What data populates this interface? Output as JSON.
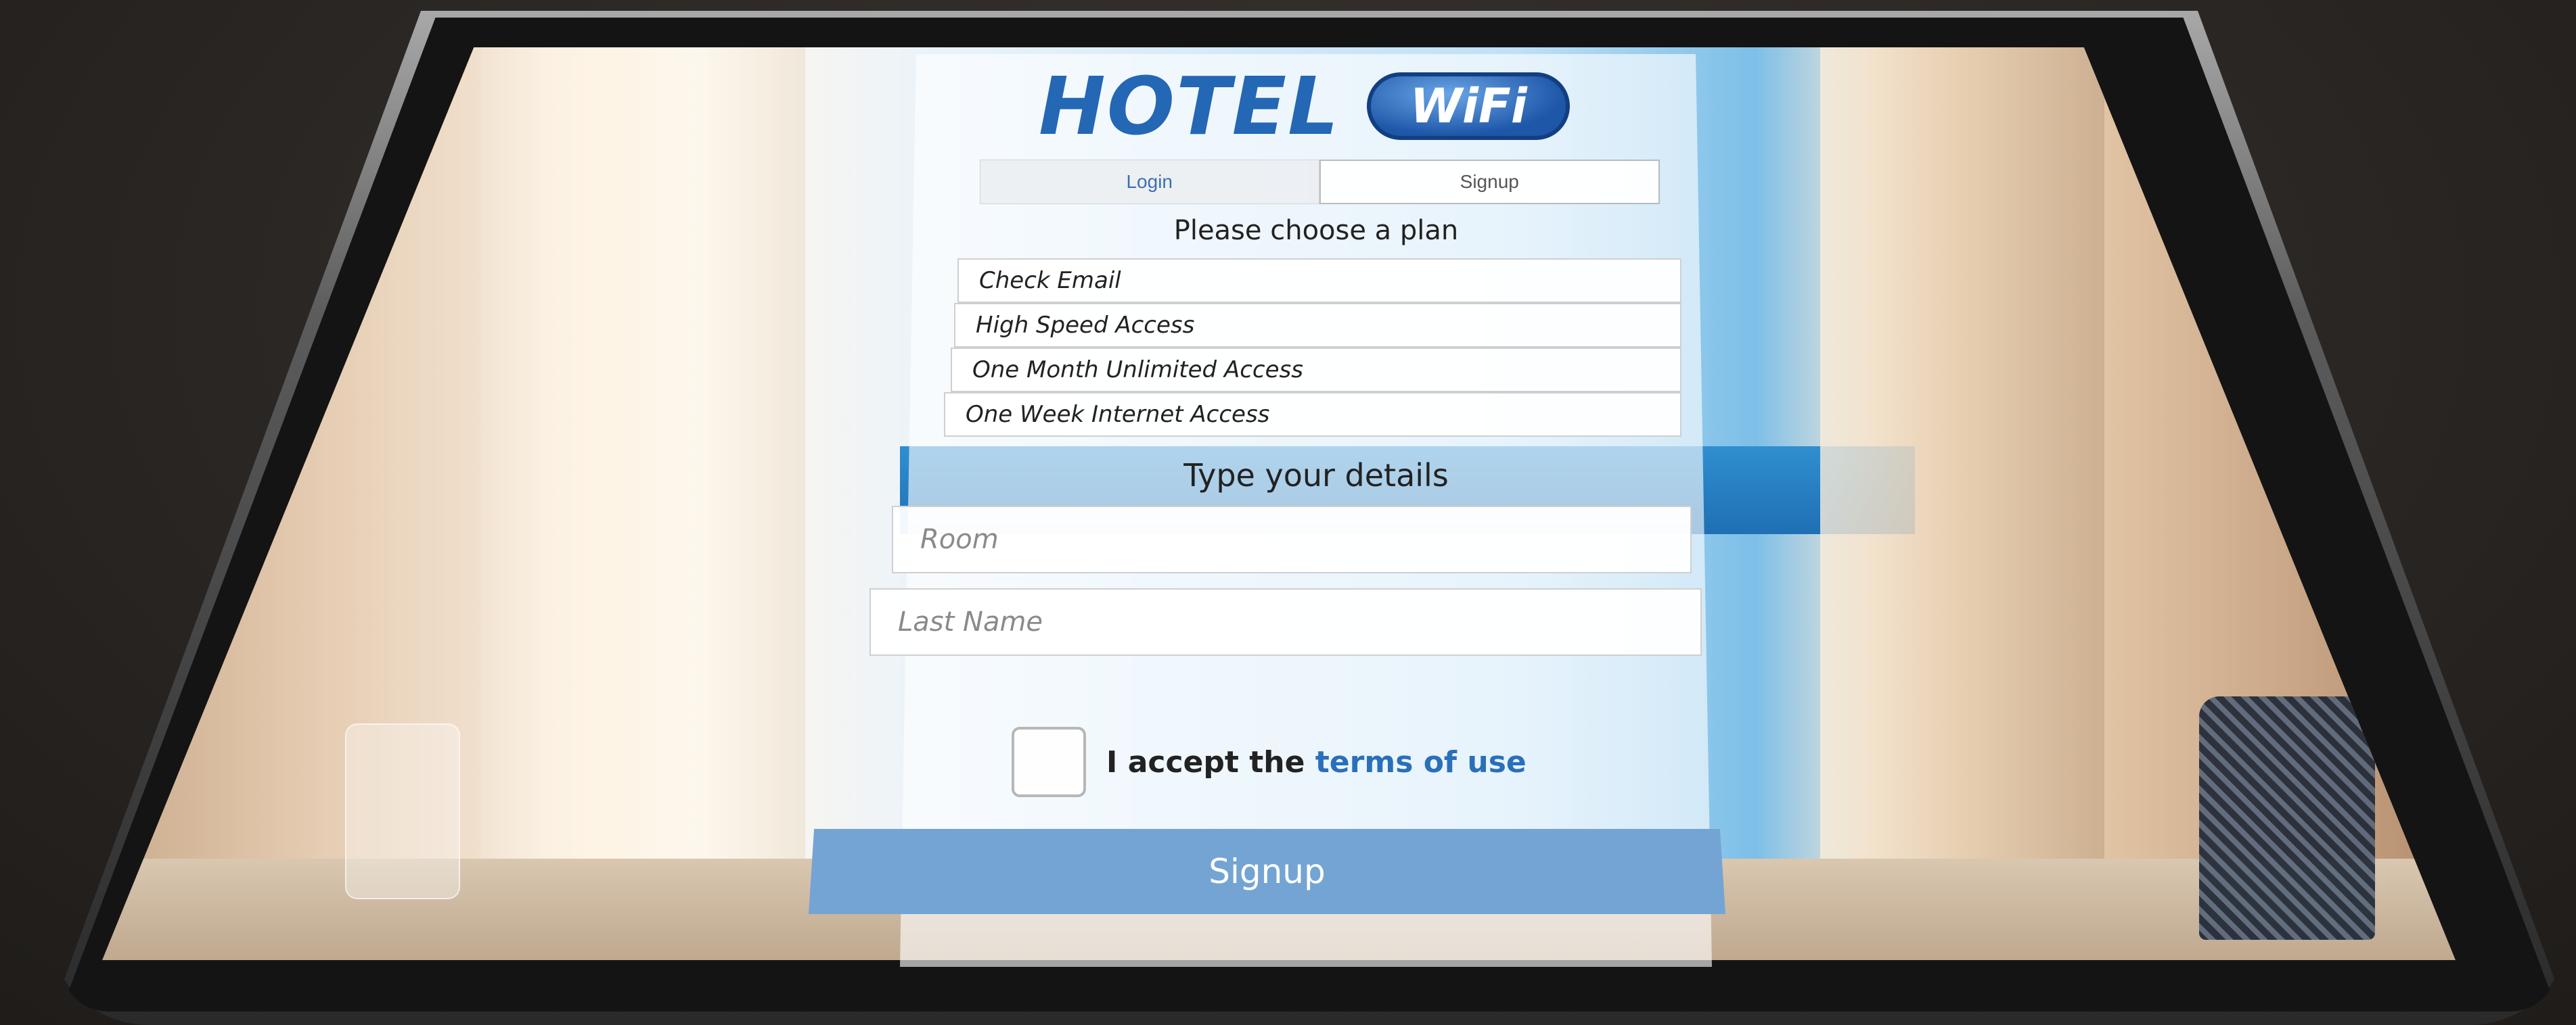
{
  "logo": {
    "hotel_text": "HOTEL",
    "wifi_text": "WiFi",
    "brand_color": "#2467b5"
  },
  "tabs": [
    {
      "label": "Login"
    },
    {
      "label": "Signup"
    }
  ],
  "plan_section": {
    "heading": "Please choose a plan",
    "plans": [
      {
        "label": "Check Email"
      },
      {
        "label": "High Speed Access"
      },
      {
        "label": "One Month Unlimited Access"
      },
      {
        "label": "One Week Internet Access"
      }
    ]
  },
  "details_section": {
    "heading": "Type your details",
    "room_placeholder": "Room",
    "lastname_placeholder": "Last Name"
  },
  "terms": {
    "prefix": "I accept the ",
    "link": "terms of use"
  },
  "signup_button": {
    "label": "Signup",
    "color": "#74a4d3"
  }
}
